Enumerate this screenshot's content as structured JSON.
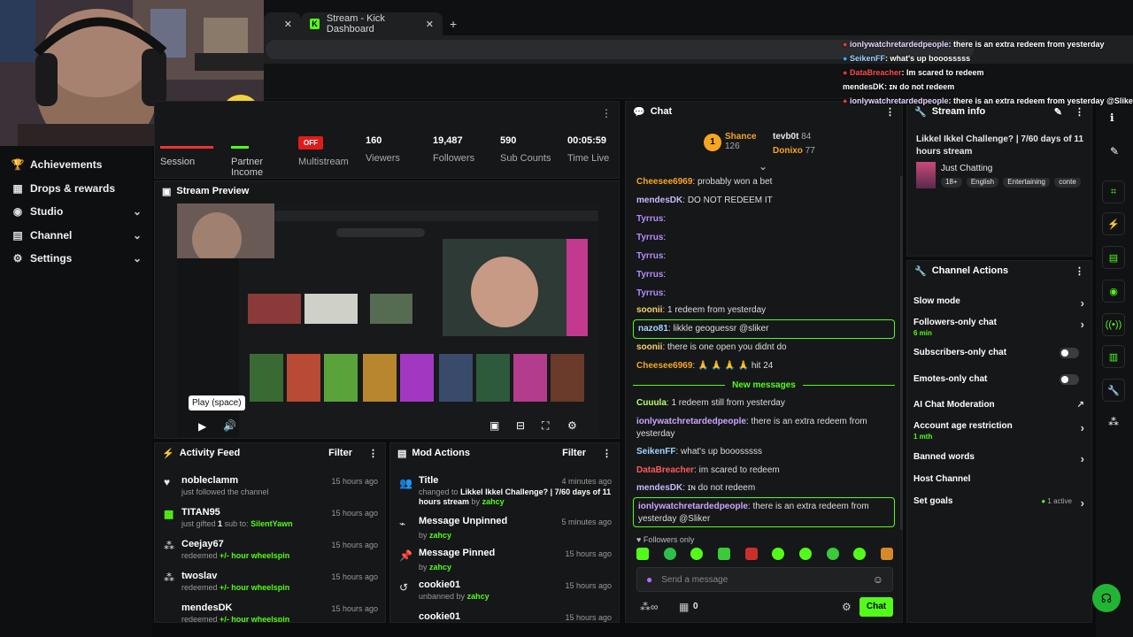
{
  "browser": {
    "active_tab": "Stream - Kick Dashboard"
  },
  "sidebar": {
    "items": [
      {
        "label": "Achievements",
        "icon": "trophy-icon"
      },
      {
        "label": "Drops & rewards",
        "icon": "gift-icon"
      },
      {
        "label": "Studio",
        "icon": "studio-icon"
      },
      {
        "label": "Channel",
        "icon": "channel-icon"
      },
      {
        "label": "Settings",
        "icon": "gear-icon"
      }
    ]
  },
  "stats": {
    "session_label": "Session",
    "partner_label": "Partner Income",
    "multistream_badge": "OFF",
    "multistream_label": "Multistream",
    "viewers_value": "160",
    "viewers_label": "Viewers",
    "followers_value": "19,487",
    "followers_label": "Followers",
    "subs_value": "590",
    "subs_label": "Sub Counts",
    "time_value": "00:05:59",
    "time_label": "Time Live"
  },
  "preview": {
    "title": "Stream Preview",
    "tooltip": "Play (space)"
  },
  "activity": {
    "title": "Activity Feed",
    "filter": "Filter",
    "items": [
      {
        "user": "nobleclamm",
        "desc": "just followed the channel",
        "time": "15 hours ago"
      },
      {
        "user": "TITAN95",
        "desc_prefix": "just gifted",
        "desc_count": "1",
        "desc_mid": "sub to:",
        "desc_target": "SilentYawn",
        "time": "15 hours ago"
      },
      {
        "user": "Ceejay67",
        "desc_prefix": "redeemed",
        "desc_reward": "+/- hour wheelspin",
        "time": "15 hours ago"
      },
      {
        "user": "twoslav",
        "desc_prefix": "redeemed",
        "desc_reward": "+/- hour wheelspin",
        "time": "15 hours ago"
      },
      {
        "user": "mendesDK",
        "desc_prefix": "redeemed",
        "desc_reward": "+/- hour wheelspin",
        "time": "15 hours ago"
      }
    ]
  },
  "mod": {
    "title": "Mod Actions",
    "filter": "Filter",
    "items": [
      {
        "action": "Title",
        "time": "4 minutes ago",
        "desc_prefix": "changed to",
        "desc_value": "Likkel Ikkel Challenge? | 7/60 days of 11 hours stream",
        "by": "by",
        "mod": "zahcy"
      },
      {
        "action": "Message Unpinned",
        "time": "5 minutes ago",
        "by": "by",
        "mod": "zahcy"
      },
      {
        "action": "Message Pinned",
        "time": "15 hours ago",
        "by": "by",
        "mod": "zahcy"
      },
      {
        "action": "cookie01",
        "time": "15 hours ago",
        "desc_prefix": "unbanned by",
        "mod": "zahcy"
      },
      {
        "action": "cookie01",
        "time": "15 hours ago"
      }
    ]
  },
  "chat": {
    "title": "Chat",
    "top_gifter_1": "Shance",
    "top_gifter_1_count": "126",
    "top_gifter_2": "tevb0t",
    "top_gifter_2_count": "84",
    "top_gifter_3": "Donixo",
    "top_gifter_3_count": "77",
    "messages": [
      {
        "user": "Cheesee6969",
        "text": "probably won a bet",
        "color": "#f5a623"
      },
      {
        "user": "mendesDK",
        "text": "DO NOT REDEEM IT",
        "color": "#c7b8ff"
      },
      {
        "user": "Tyrrus",
        "text": "",
        "color": "#b38cff"
      },
      {
        "user": "Tyrrus",
        "text": "",
        "color": "#b38cff"
      },
      {
        "user": "Tyrrus",
        "text": "",
        "color": "#b38cff"
      },
      {
        "user": "Tyrrus",
        "text": "",
        "color": "#b38cff"
      },
      {
        "user": "Tyrrus",
        "text": "",
        "color": "#b38cff"
      },
      {
        "user": "soonii",
        "text": "1 redeem from yesterday",
        "color": "#f5d36e"
      },
      {
        "user": "nazo81",
        "text": "likkle geoguessr @sliker",
        "color": "#9fd6ff"
      },
      {
        "user": "soonii",
        "text": "there is one open you didnt do",
        "color": "#f5d36e"
      },
      {
        "user": "Cheesee6969",
        "text": "🙏 🙏 🙏 🙏 hit 24",
        "color": "#f5a623"
      },
      {
        "user": "Cuuula",
        "text": "1 redeem still from yesterday",
        "color": "#b6ff6b"
      },
      {
        "user": "ionlywatchretardedpeople",
        "text": "there is an extra redeem from yesterday",
        "color": "#c9a6ff"
      },
      {
        "user": "SeikenFF",
        "text": "what's up booosssss",
        "color": "#9fd6ff"
      },
      {
        "user": "DataBreacher",
        "text": "im scared to redeem",
        "color": "#ff5a5a"
      },
      {
        "user": "mendesDK",
        "text": "ɪɴ do not redeem",
        "color": "#c7b8ff"
      },
      {
        "user": "ionlywatchretardedpeople",
        "text": "there is an extra redeem from yesterday @Sliker",
        "color": "#c9a6ff"
      }
    ],
    "new_messages": "New messages",
    "followers_only": "Followers only",
    "input_placeholder": "Send a message",
    "count": "0",
    "send": "Chat"
  },
  "info": {
    "title": "Stream info",
    "stream_title": "Likkel Ikkel Challenge? | 7/60 days of 11 hours stream",
    "category": "Just Chatting",
    "tags": [
      "18+",
      "English",
      "Entertaining",
      "conte"
    ]
  },
  "actions": {
    "title": "Channel Actions",
    "items": [
      {
        "label": "Slow mode",
        "control": "arrow"
      },
      {
        "label": "Followers-only chat",
        "sub": "6 min",
        "control": "arrow"
      },
      {
        "label": "Subscribers-only chat",
        "control": "toggle"
      },
      {
        "label": "Emotes-only chat",
        "control": "toggle"
      },
      {
        "label": "AI Chat Moderation",
        "control": "external"
      },
      {
        "label": "Account age restriction",
        "sub": "1 mth",
        "control": "arrow"
      },
      {
        "label": "Banned words",
        "control": "arrow"
      },
      {
        "label": "Host Channel",
        "control": "none"
      },
      {
        "label": "Set goals",
        "badge": "1 active",
        "control": "arrow"
      }
    ]
  },
  "overlay": [
    {
      "user": "ionlywatchretardedpeople",
      "text": ": there is an extra redeem from yesterday",
      "color": "#e7d6ff"
    },
    {
      "user": "SeikenFF",
      "text": ": what's up booosssss",
      "color": "#9fd6ff"
    },
    {
      "user": "DataBreacher",
      "text": ": Im scared to redeem",
      "color": "#ff4d4d"
    },
    {
      "user": "mendesDK",
      "text": ": ɪɴ do not redeem",
      "color": "#ffffff"
    },
    {
      "user": "ionlywatchretardedpeople",
      "text": ": there is an extra redeem from yesterday @Sliker",
      "color": "#e7d6ff"
    }
  ]
}
